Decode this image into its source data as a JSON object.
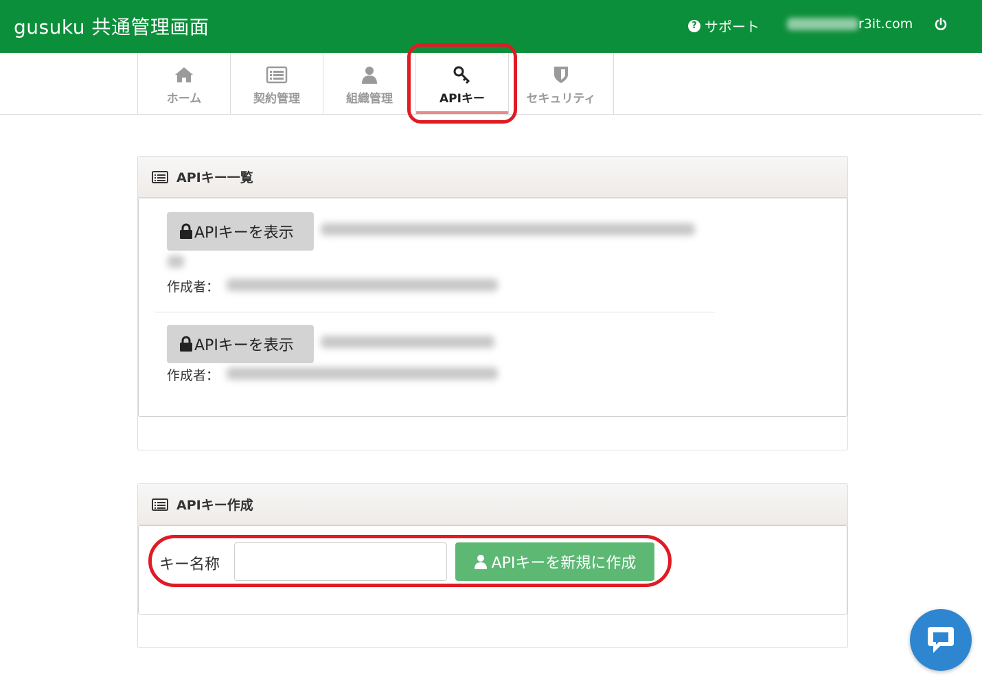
{
  "header": {
    "title": "gusuku 共通管理画面",
    "support_label": "サポート",
    "email_visible": "r3it.com"
  },
  "tabs": [
    {
      "label": "ホーム",
      "icon": "home-icon"
    },
    {
      "label": "契約管理",
      "icon": "contract-list-icon"
    },
    {
      "label": "組織管理",
      "icon": "user-icon"
    },
    {
      "label": "APIキー",
      "icon": "key-icon",
      "active": true
    },
    {
      "label": "セキュリティ",
      "icon": "shield-icon"
    }
  ],
  "api_list": {
    "title": "APIキー一覧",
    "items": [
      {
        "button_label": "APIキーを表示",
        "creator_label": "作成者："
      },
      {
        "button_label": "APIキーを表示",
        "creator_label": "作成者："
      }
    ]
  },
  "api_create": {
    "title": "APIキー作成",
    "name_label": "キー名称",
    "name_value": "",
    "button_label": "APIキーを新規に作成"
  },
  "colors": {
    "header_bg": "#0c8f3a",
    "active_tab_underline": "#e98a86",
    "create_button": "#5cb873",
    "annotation": "#e01b24",
    "chat_button": "#2e86d1"
  }
}
